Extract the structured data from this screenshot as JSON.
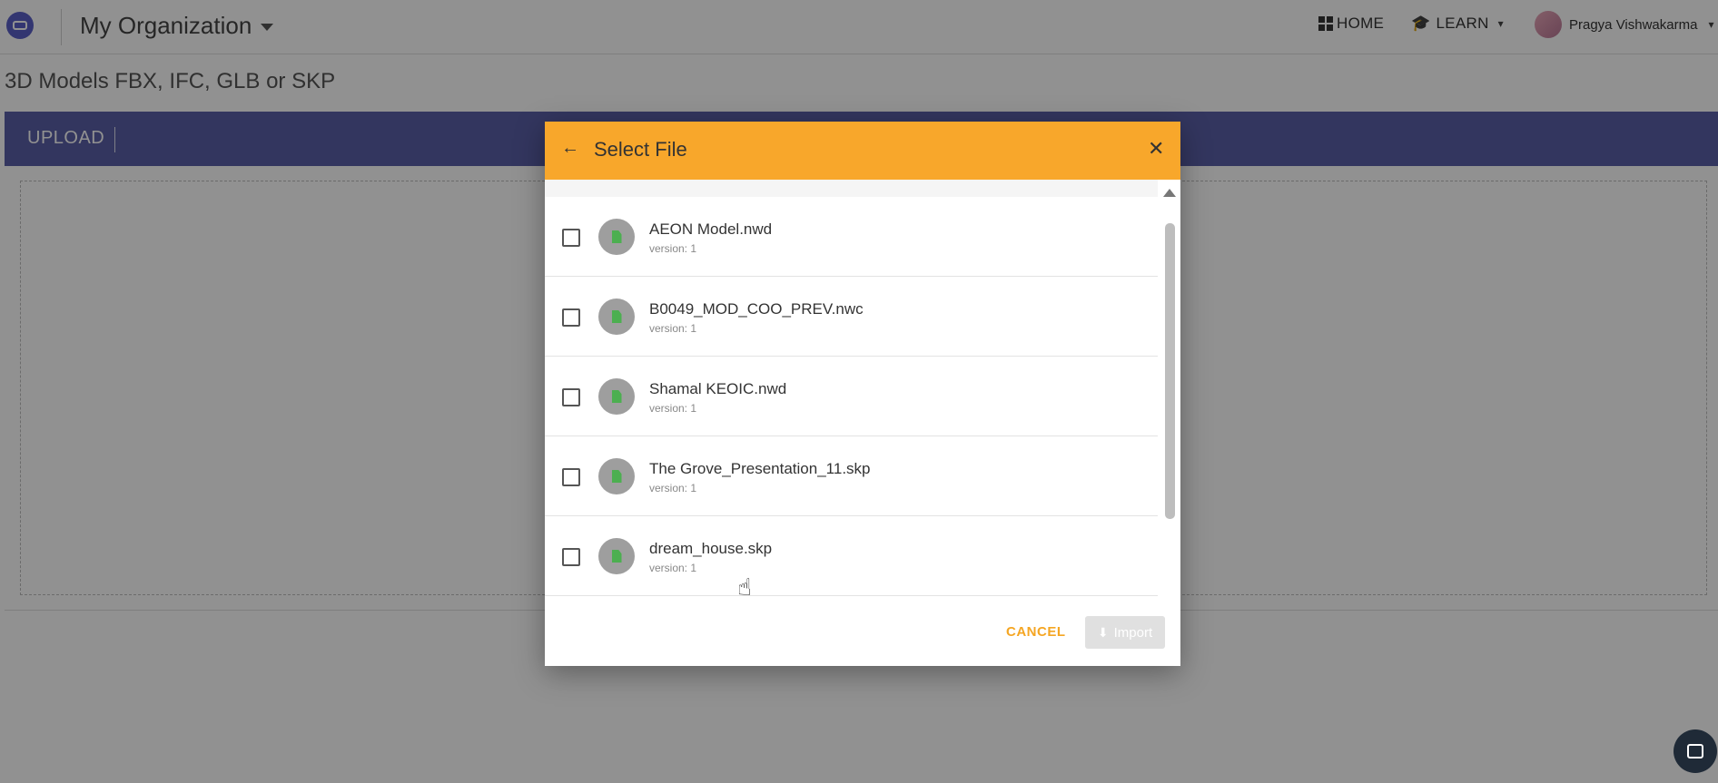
{
  "app": {
    "org_name": "My Organization",
    "nav_home": "HOME",
    "nav_learn": "LEARN",
    "user_name": "Pragya Vishwakarma",
    "page_title": "3D Models FBX, IFC, GLB or SKP",
    "upload_label": "UPLOAD"
  },
  "dialog": {
    "title": "Select File",
    "files": [
      {
        "name": "AEON Model.nwd",
        "version": "version: 1"
      },
      {
        "name": "B0049_MOD_COO_PREV.nwc",
        "version": "version: 1"
      },
      {
        "name": "Shamal KEOIC.nwd",
        "version": "version: 1"
      },
      {
        "name": "The Grove_Presentation_11.skp",
        "version": "version: 1"
      },
      {
        "name": "dream_house.skp",
        "version": "version: 1"
      }
    ],
    "cancel_label": "CANCEL",
    "import_label": "Import"
  },
  "icons": {
    "logo": "logo-icon",
    "home": "grid-icon",
    "learn": "graduation-cap-icon",
    "back": "arrow-left-icon",
    "close": "close-icon",
    "file": "file-icon",
    "import": "download-icon",
    "chat": "chat-icon"
  },
  "colors": {
    "dialog_header": "#f8a72b",
    "upload_bar": "#5b5fa8",
    "cancel_text": "#f5a623",
    "file_glyph": "#4caf50"
  }
}
